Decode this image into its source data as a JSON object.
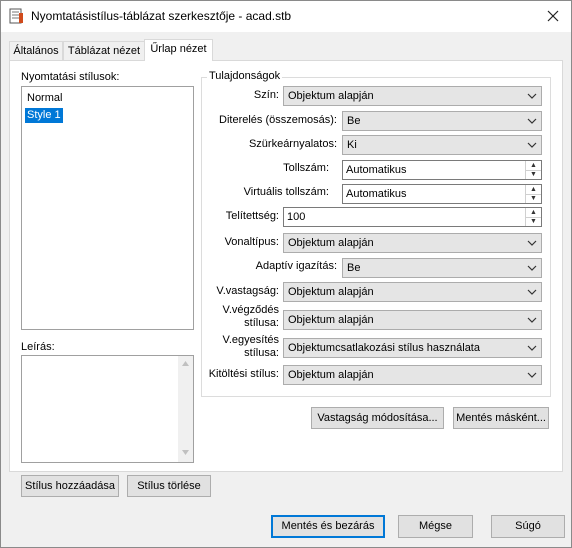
{
  "window": {
    "title": "Nyomtatásistílus-táblázat szerkesztője - acad.stb",
    "close_label": "✕"
  },
  "tabs": [
    {
      "label": "Általános"
    },
    {
      "label": "Táblázat nézet"
    },
    {
      "label": "Űrlap nézet"
    }
  ],
  "styles_panel": {
    "label": "Nyomtatási stílusok:",
    "items": [
      "Normal",
      "Style 1"
    ],
    "selected": "Style 1",
    "description_label": "Leírás:",
    "description_value": "",
    "add_button": "Stílus hozzáadása",
    "delete_button": "Stílus törlése"
  },
  "properties": {
    "group_title": "Tulajdonságok",
    "color": {
      "label": "Szín:",
      "value": "Objektum alapján"
    },
    "dither": {
      "label": "Diterelés (összemosás):",
      "value": "Be"
    },
    "grayscale": {
      "label": "Szürkeárnyalatos:",
      "value": "Ki"
    },
    "pen": {
      "label": "Tollszám:",
      "value": "Automatikus"
    },
    "virtual_pen": {
      "label": "Virtuális tollszám:",
      "value": "Automatikus"
    },
    "screening": {
      "label": "Telítettség:",
      "value": "100"
    },
    "linetype": {
      "label": "Vonaltípus:",
      "value": "Objektum alapján"
    },
    "adaptive": {
      "label": "Adaptív igazítás:",
      "value": "Be"
    },
    "lineweight": {
      "label": "V.vastagság:",
      "value": "Objektum alapján"
    },
    "line_end": {
      "label_1": "V.végződés",
      "label_2": "stílusa:",
      "value": "Objektum alapján"
    },
    "line_join": {
      "label_1": "V.egyesítés",
      "label_2": "stílusa:",
      "value": "Objektumcsatlakozási stílus használata"
    },
    "fill": {
      "label": "Kitöltési stílus:",
      "value": "Objektum alapján"
    },
    "edit_lineweights_button": "Vastagság módosítása...",
    "save_as_button": "Mentés másként..."
  },
  "footer": {
    "save_close": "Mentés és bezárás",
    "cancel": "Mégse",
    "help": "Súgó"
  }
}
